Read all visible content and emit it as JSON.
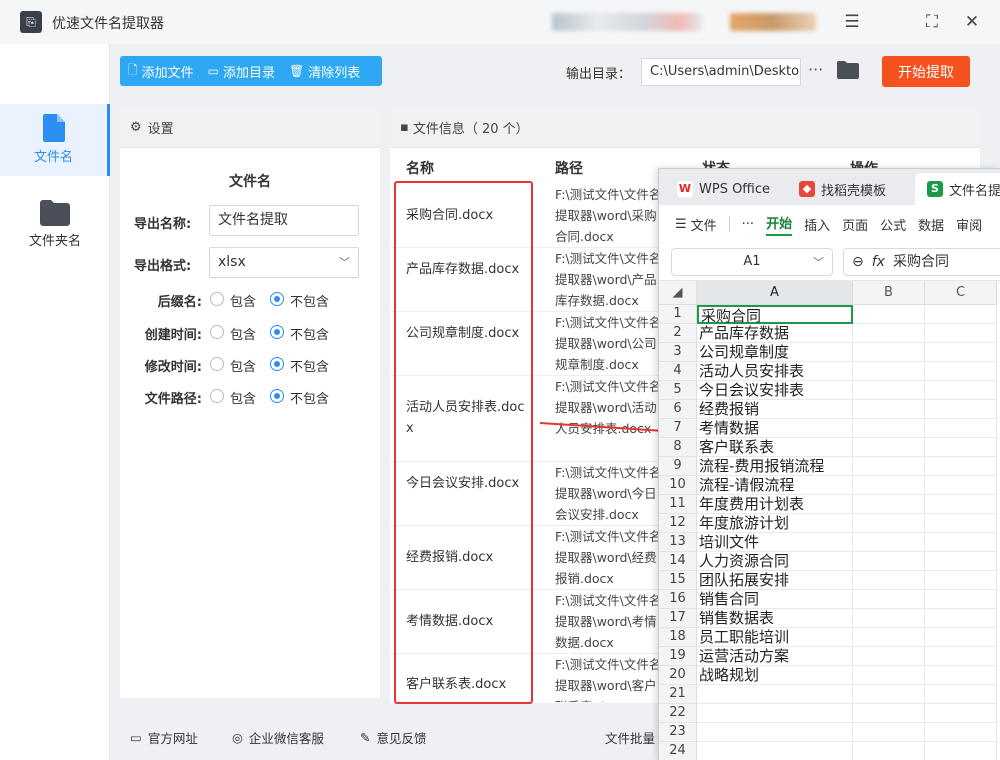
{
  "app": {
    "title": "优速文件名提取器"
  },
  "nav": {
    "items": [
      {
        "label": "文件名"
      },
      {
        "label": "文件夹名"
      }
    ]
  },
  "toolbar": {
    "add_file": "添加文件",
    "add_dir": "添加目录",
    "clear_list": "清除列表",
    "output_label": "输出目录：",
    "output_value": "C:\\Users\\admin\\Desktop",
    "more": "···",
    "start": "开始提取"
  },
  "settings": {
    "header": "设置",
    "section": "文件名",
    "export_name_label": "导出名称:",
    "export_name_value": "文件名提取",
    "export_format_label": "导出格式:",
    "export_format_value": "xlsx",
    "include": "包含",
    "exclude": "不包含",
    "options": [
      {
        "label": "后缀名:",
        "selected": "exclude"
      },
      {
        "label": "创建时间:",
        "selected": "exclude"
      },
      {
        "label": "修改时间:",
        "selected": "exclude"
      },
      {
        "label": "文件路径:",
        "selected": "exclude"
      }
    ]
  },
  "files": {
    "header": "文件信息（ 20 个）",
    "columns": {
      "name": "名称",
      "path": "路径",
      "status": "状态",
      "action": "操作"
    },
    "rows": [
      {
        "name": "采购合同.docx",
        "path": "F:\\测试文件\\文件名提取器\\word\\采购合同.docx"
      },
      {
        "name": "产品库存数据.docx",
        "path": "F:\\测试文件\\文件名提取器\\word\\产品库存数据.docx"
      },
      {
        "name": "公司规章制度.docx",
        "path": "F:\\测试文件\\文件名提取器\\word\\公司规章制度.docx"
      },
      {
        "name": "活动人员安排表.docx",
        "path": "F:\\测试文件\\文件名提取器\\word\\活动人员安排表.docx"
      },
      {
        "name": "今日会议安排.docx",
        "path": "F:\\测试文件\\文件名提取器\\word\\今日会议安排.docx"
      },
      {
        "name": "经费报销.docx",
        "path": "F:\\测试文件\\文件名提取器\\word\\经费报销.docx"
      },
      {
        "name": "考情数据.docx",
        "path": "F:\\测试文件\\文件名提取器\\word\\考情数据.docx"
      },
      {
        "name": "客户联系表.docx",
        "path": "F:\\测试文件\\文件名提取器\\word\\客户联系表.docx"
      }
    ]
  },
  "footer": {
    "website": "官方网址",
    "wechat": "企业微信客服",
    "feedback": "意见反馈",
    "right_text": "文件批量"
  },
  "wps": {
    "tabs": [
      "WPS Office",
      "找稻壳模板",
      "文件名提取"
    ],
    "menu": [
      "文件",
      "···",
      "开始",
      "插入",
      "页面",
      "公式",
      "数据",
      "审阅"
    ],
    "active_menu": "开始",
    "cell_ref": "A1",
    "formula_value": "采购合同",
    "columns": [
      "A",
      "B",
      "C"
    ],
    "rows": [
      {
        "n": "1",
        "a": "采购合同"
      },
      {
        "n": "2",
        "a": "产品库存数据"
      },
      {
        "n": "3",
        "a": "公司规章制度"
      },
      {
        "n": "4",
        "a": "活动人员安排表"
      },
      {
        "n": "5",
        "a": "今日会议安排表"
      },
      {
        "n": "6",
        "a": "经费报销"
      },
      {
        "n": "7",
        "a": "考情数据"
      },
      {
        "n": "8",
        "a": "客户联系表"
      },
      {
        "n": "9",
        "a": "流程-费用报销流程"
      },
      {
        "n": "10",
        "a": "流程-请假流程"
      },
      {
        "n": "11",
        "a": "年度费用计划表"
      },
      {
        "n": "12",
        "a": "年度旅游计划"
      },
      {
        "n": "13",
        "a": "培训文件"
      },
      {
        "n": "14",
        "a": "人力资源合同"
      },
      {
        "n": "15",
        "a": "团队拓展安排"
      },
      {
        "n": "16",
        "a": "销售合同"
      },
      {
        "n": "17",
        "a": "销售数据表"
      },
      {
        "n": "18",
        "a": "员工职能培训"
      },
      {
        "n": "19",
        "a": "运营活动方案"
      },
      {
        "n": "20",
        "a": "战略规划"
      },
      {
        "n": "21",
        "a": ""
      },
      {
        "n": "22",
        "a": ""
      },
      {
        "n": "23",
        "a": ""
      },
      {
        "n": "24",
        "a": ""
      }
    ]
  },
  "colors": {
    "accent": "#2ea8f2",
    "start": "#f5511e",
    "highlight": "#e93434",
    "wps_green": "#1a9b4a"
  }
}
